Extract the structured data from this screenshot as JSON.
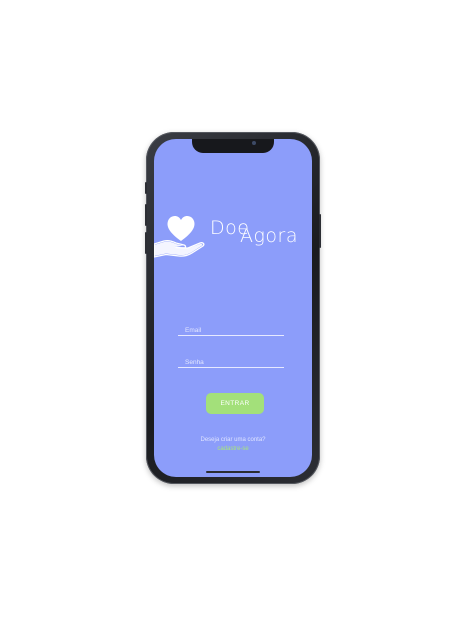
{
  "app": {
    "logo_text_1": "Doe",
    "logo_text_2": "Agora"
  },
  "icons": {
    "logo": "heart-in-hand-icon"
  },
  "form": {
    "email_placeholder": "Email",
    "email_value": "",
    "password_placeholder": "Senha",
    "password_value": "",
    "submit_label": "ENTRAR"
  },
  "footer": {
    "question": "Deseja criar uma conta?",
    "signup_link": "cadastre-se"
  },
  "colors": {
    "screen_background": "#8c9dfa",
    "button": "#a3e07a",
    "link": "#a8e67a"
  }
}
